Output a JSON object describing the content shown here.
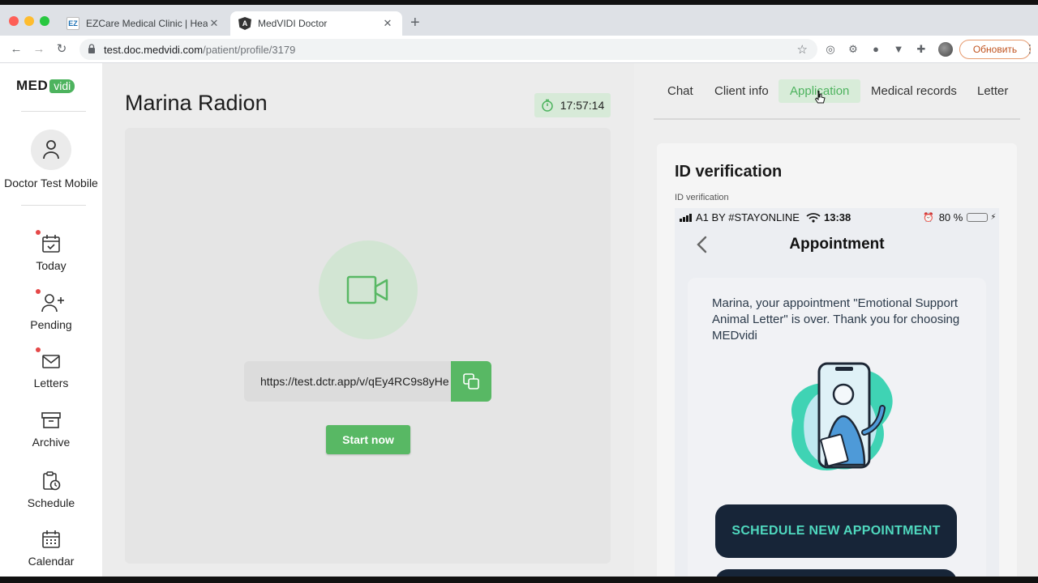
{
  "browser": {
    "tabs": [
      {
        "title": "EZCare Medical Clinic | Health",
        "favicon": "EZ"
      },
      {
        "title": "MedVIDI Doctor",
        "favicon": "A"
      }
    ],
    "url_host": "test.doc.medvidi.com",
    "url_path": "/patient/profile/3179",
    "update_label": "Обновить"
  },
  "sidebar": {
    "logo_med": "MED",
    "logo_vidi": "vidi",
    "doctor_name": "Doctor Test Mobile",
    "items": [
      {
        "label": "Today",
        "icon": "calendar-check-icon",
        "notification": true
      },
      {
        "label": "Pending",
        "icon": "user-plus-icon",
        "notification": true
      },
      {
        "label": "Letters",
        "icon": "envelope-icon",
        "notification": true
      },
      {
        "label": "Archive",
        "icon": "archive-box-icon",
        "notification": false
      },
      {
        "label": "Schedule",
        "icon": "clipboard-clock-icon",
        "notification": false
      },
      {
        "label": "Calendar",
        "icon": "calendar-grid-icon",
        "notification": false
      }
    ]
  },
  "main": {
    "patient_name": "Marina Radion",
    "timer": "17:57:14",
    "video_link": "https://test.dctr.app/v/qEy4RC9s8yHe",
    "start_label": "Start now"
  },
  "right": {
    "tabs": [
      {
        "label": "Chat"
      },
      {
        "label": "Client info"
      },
      {
        "label": "Application",
        "active": true
      },
      {
        "label": "Medical records"
      },
      {
        "label": "Letter"
      }
    ],
    "card_title": "ID verification",
    "card_subtitle": "ID verification",
    "phone": {
      "carrier": "A1 BY #STAYONLINE",
      "time": "13:38",
      "battery": "80 %",
      "battery_level": 0.8,
      "screen_title": "Appointment",
      "message": "Marina, your appointment \"Emotional Support Animal Letter\" is over. Thank you for choosing MEDvidi",
      "button_label": "SCHEDULE NEW APPOINTMENT"
    }
  },
  "colors": {
    "brand_green": "#58b864",
    "timer_bg": "#d7ead8",
    "phone_button_bg": "#172538",
    "phone_button_text": "#4fd8be"
  }
}
